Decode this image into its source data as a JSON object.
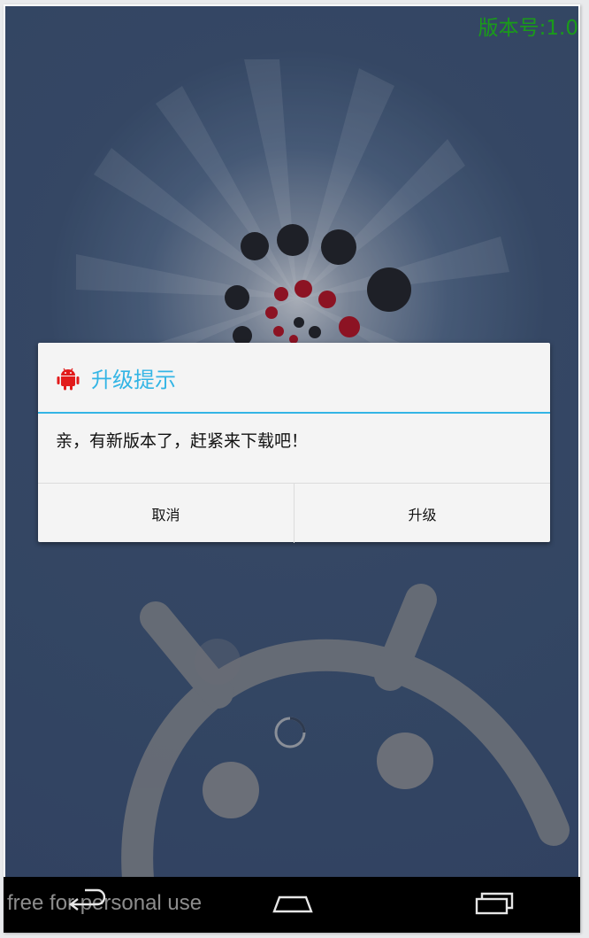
{
  "status": {
    "version_label": "版本号:1.0"
  },
  "dialog": {
    "title": "升级提示",
    "icon": "android-icon",
    "message": "亲，有新版本了，赶紧来下载吧！",
    "cancel_label": "取消",
    "upgrade_label": "升级",
    "accent_color": "#33b5e5",
    "icon_color": "#e21b1b"
  },
  "watermark": {
    "text": "free for personal use"
  },
  "navbar": {
    "back_icon": "back-icon",
    "home_icon": "home-icon",
    "recents_icon": "recents-icon"
  },
  "colors": {
    "background": "#3b4f6d",
    "version_text": "#1a9b1a",
    "dot_red": "#a50f1e",
    "dot_dark": "#1f1f23"
  }
}
